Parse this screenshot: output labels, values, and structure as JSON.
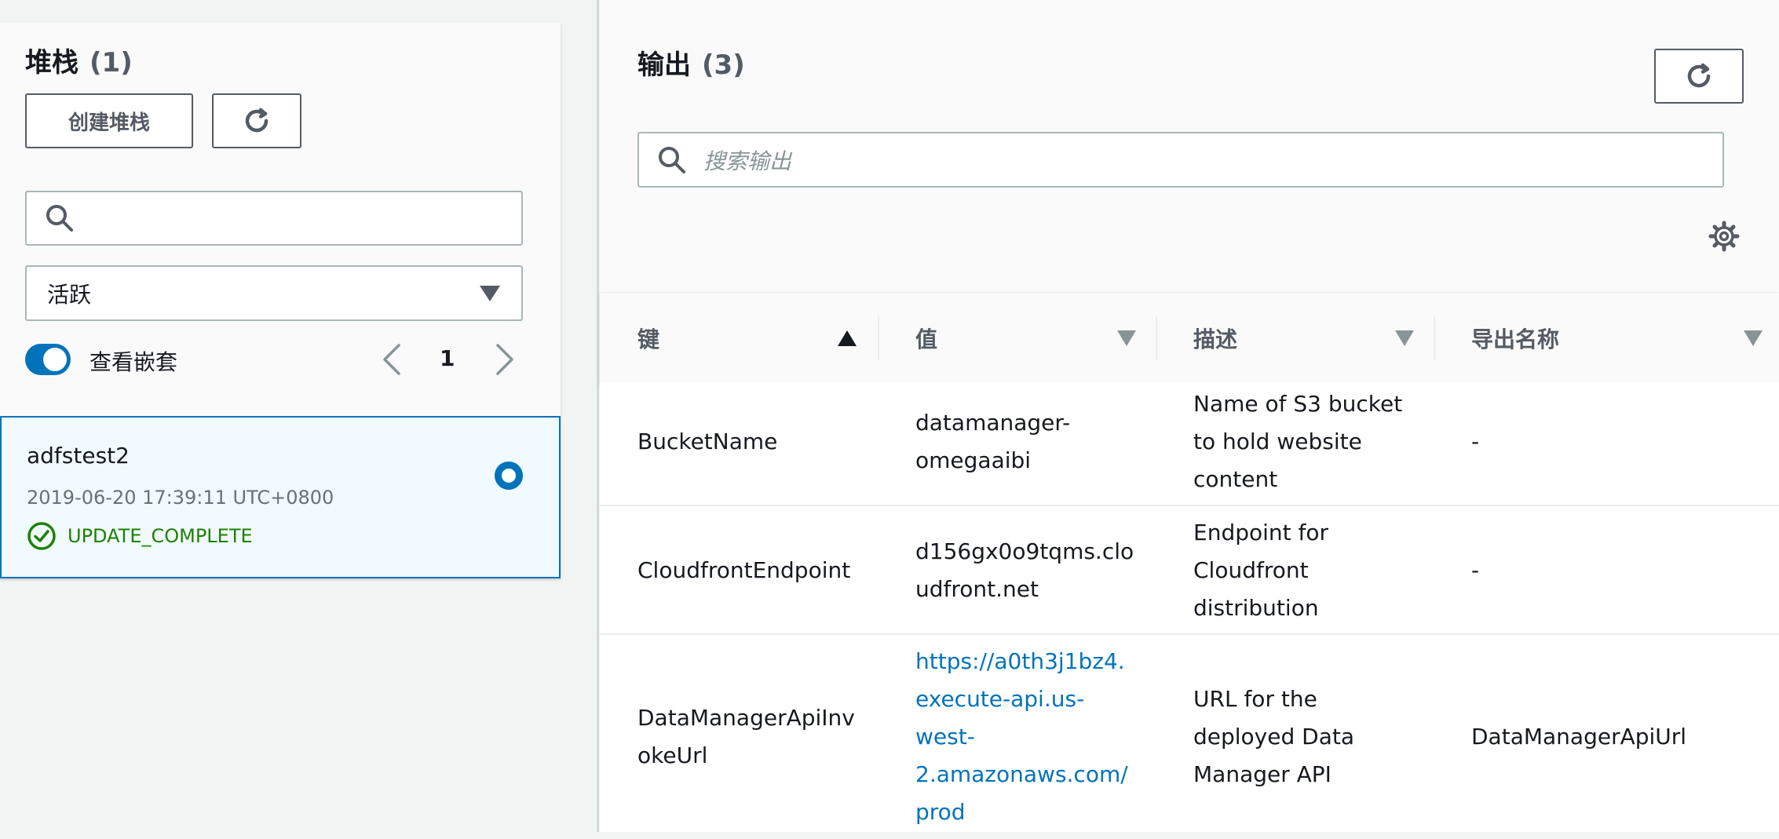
{
  "stacks_panel": {
    "title": "堆栈",
    "count": "(1)",
    "create_label": "创建堆栈",
    "filter_value": "活跃",
    "toggle_label": "查看嵌套",
    "toggle_on": true,
    "page_number": "1",
    "items": [
      {
        "name": "adfstest2",
        "date": "2019-06-20 17:39:11 UTC+0800",
        "status": "UPDATE_COMPLETE",
        "selected": true
      }
    ]
  },
  "outputs_panel": {
    "title": "输出",
    "count": "(3)",
    "search_placeholder": "搜索输出",
    "columns": [
      {
        "label": "键",
        "sort": "ascending"
      },
      {
        "label": "值",
        "sort": "none"
      },
      {
        "label": "描述",
        "sort": "none"
      },
      {
        "label": "导出名称",
        "sort": "none"
      }
    ],
    "rows": [
      {
        "key": [
          "BucketName"
        ],
        "value": [
          "datamanager-",
          "omegaaibi"
        ],
        "description": [
          "Name of S3 bucket",
          "to hold website",
          "content"
        ],
        "export": [
          "-"
        ]
      },
      {
        "key": [
          "CloudfrontEndpoint"
        ],
        "value": [
          "d156gx0o9tqms.clo",
          "udfront.net"
        ],
        "description": [
          "Endpoint for",
          "Cloudfront",
          "distribution"
        ],
        "export": [
          "-"
        ]
      },
      {
        "key": [
          "DataManagerApiInv",
          "okeUrl"
        ],
        "value": [
          "https://a0th3j1bz4.",
          "execute-api.us-",
          "west-",
          "2.amazonaws.com/",
          "prod"
        ],
        "description": [
          "URL for the",
          "deployed Data",
          "Manager API"
        ],
        "export": [
          "DataManagerApiUrl"
        ]
      }
    ]
  },
  "colors": {
    "primary": "#0073bb",
    "success": "#1d8102",
    "selected_bg": "#f1faff",
    "text_secondary": "#687078"
  }
}
